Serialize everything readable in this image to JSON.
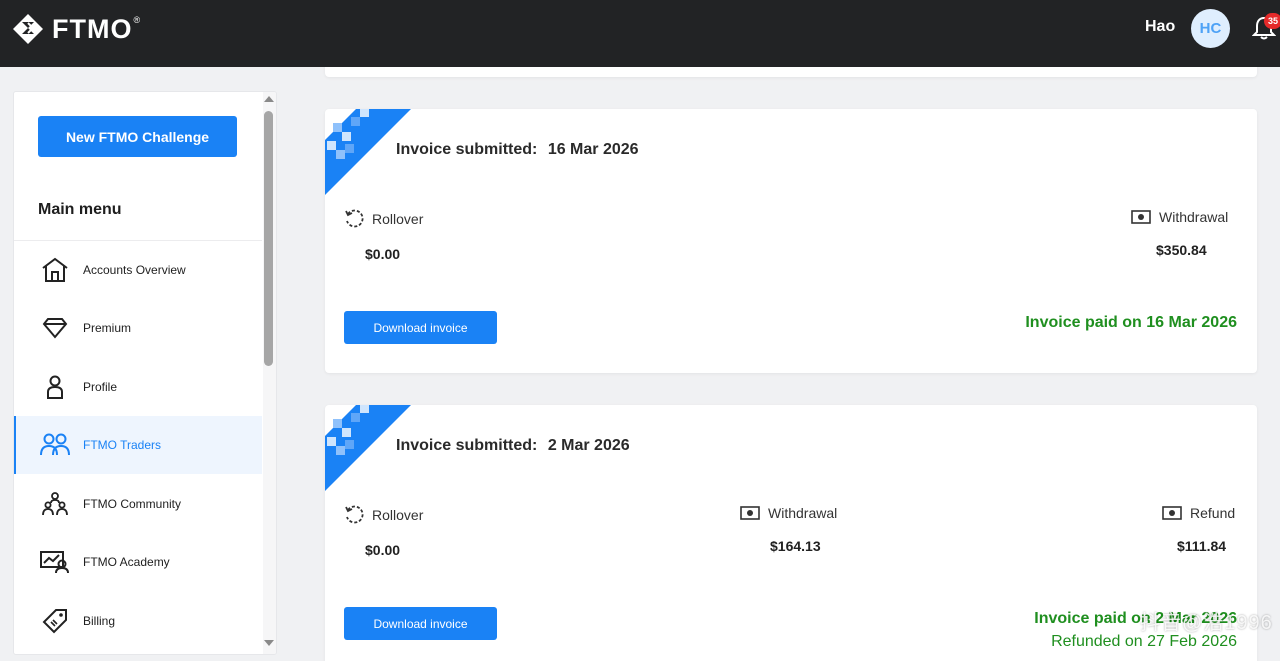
{
  "header": {
    "logo_text": "FTMO",
    "logo_reg": "®",
    "user_name": "Hao",
    "avatar_initials": "HC",
    "notification_count": "35"
  },
  "sidebar": {
    "new_challenge_label": "New FTMO Challenge",
    "main_menu_title": "Main menu",
    "items": [
      {
        "label": "Accounts Overview",
        "icon": "house-icon"
      },
      {
        "label": "Premium",
        "icon": "diamond-icon"
      },
      {
        "label": "Profile",
        "icon": "person-icon"
      },
      {
        "label": "FTMO Traders",
        "icon": "people-icon",
        "active": true
      },
      {
        "label": "FTMO Community",
        "icon": "community-icon"
      },
      {
        "label": "FTMO Academy",
        "icon": "academy-icon"
      },
      {
        "label": "Billing",
        "icon": "tag-icon"
      }
    ]
  },
  "invoices": [
    {
      "submitted_label": "Invoice submitted:",
      "submitted_date": "16 Mar 2026",
      "fields": [
        {
          "label": "Rollover",
          "value": "$0.00",
          "icon": "rollover-icon"
        },
        {
          "label": "Withdrawal",
          "value": "$350.84",
          "icon": "cash-icon"
        }
      ],
      "download_label": "Download invoice",
      "status": "Invoice paid on 16 Mar 2026"
    },
    {
      "submitted_label": "Invoice submitted:",
      "submitted_date": "2 Mar 2026",
      "fields": [
        {
          "label": "Rollover",
          "value": "$0.00",
          "icon": "rollover-icon"
        },
        {
          "label": "Withdrawal",
          "value": "$164.13",
          "icon": "cash-icon"
        },
        {
          "label": "Refund",
          "value": "$111.84",
          "icon": "cash-icon"
        }
      ],
      "download_label": "Download invoice",
      "status": "Invoice paid on 2 Mar 2026",
      "status2": "Refunded on 27 Feb 2026"
    }
  ],
  "watermark": "抖音@浩1996",
  "colors": {
    "topbar": "#222325",
    "accent": "#1a82f5",
    "success": "#1f8f1f"
  }
}
